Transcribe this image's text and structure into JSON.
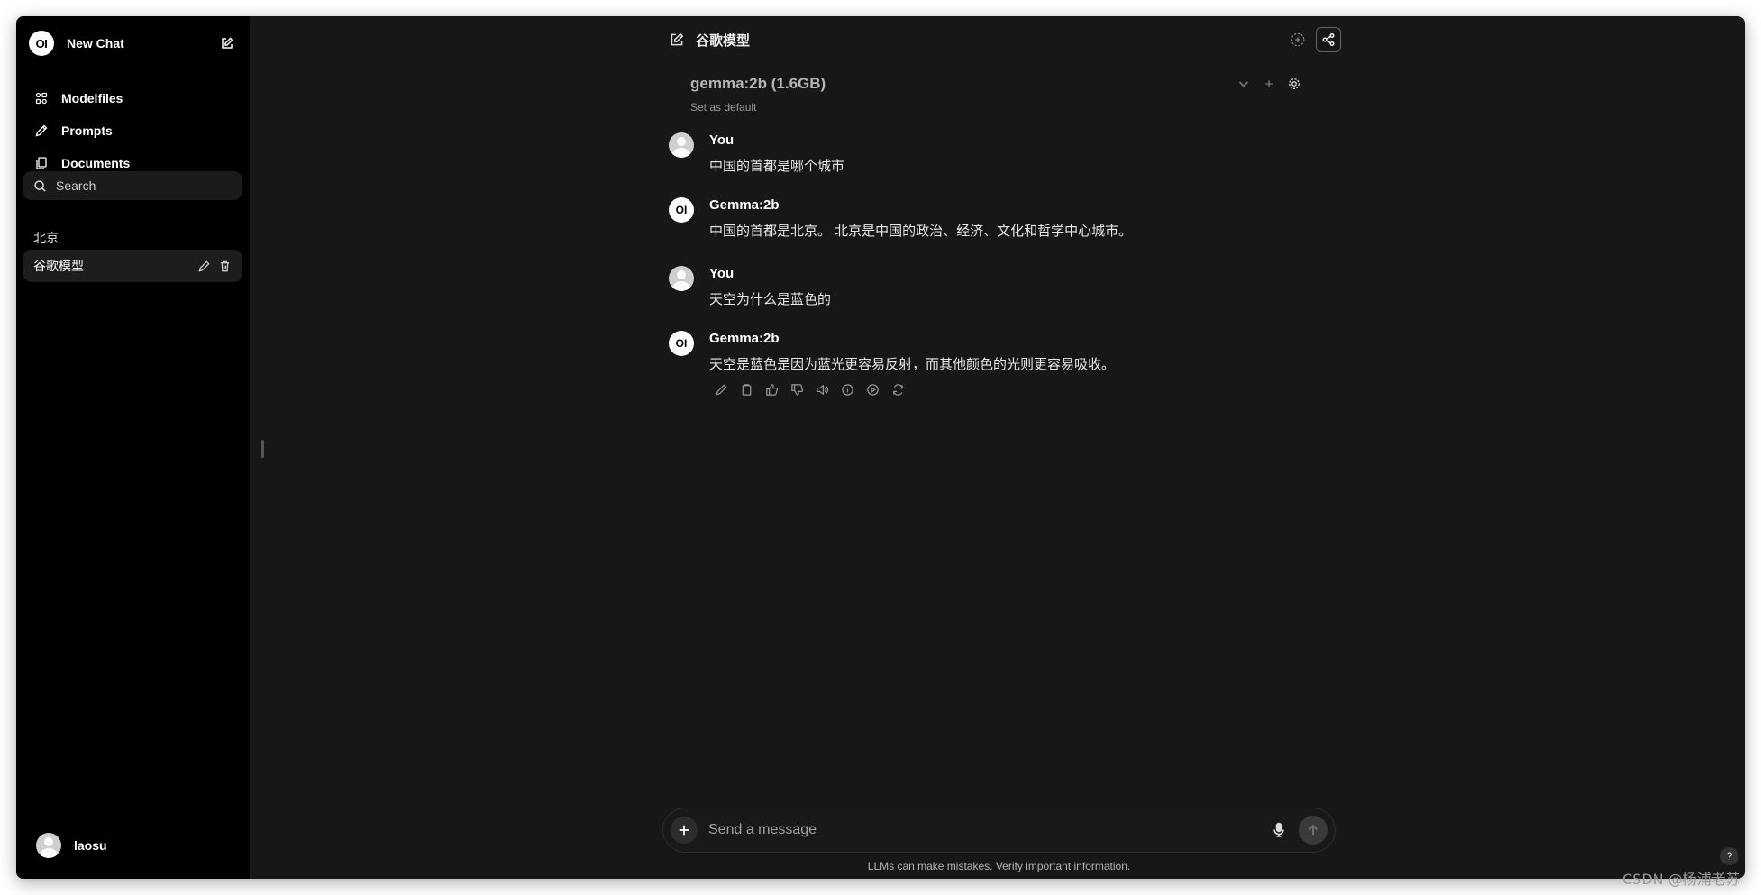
{
  "sidebar": {
    "logo_text": "OI",
    "new_chat_label": "New Chat",
    "nav": [
      {
        "label": "Modelfiles",
        "icon": "modelfiles-icon"
      },
      {
        "label": "Prompts",
        "icon": "pencil-icon"
      },
      {
        "label": "Documents",
        "icon": "documents-icon"
      }
    ],
    "search_placeholder": "Search",
    "group_label": "北京",
    "active_chat": "谷歌模型",
    "user_name": "laosu"
  },
  "header": {
    "title": "谷歌模型",
    "model_name": "gemma:2b (1.6GB)",
    "set_default": "Set as default"
  },
  "messages": [
    {
      "sender": "You",
      "text": "中国的首都是哪个城市",
      "role": "user"
    },
    {
      "sender": "Gemma:2b",
      "text": "中国的首都是北京。 北京是中国的政治、经济、文化和哲学中心城市。",
      "role": "assistant"
    },
    {
      "sender": "You",
      "text": "天空为什么是蓝色的",
      "role": "user"
    },
    {
      "sender": "Gemma:2b",
      "text": "天空是蓝色是因为蓝光更容易反射，而其他颜色的光则更容易吸收。",
      "role": "assistant"
    }
  ],
  "composer": {
    "placeholder": "Send a message"
  },
  "disclaimer": "LLMs can make mistakes. Verify important information.",
  "help_label": "?",
  "watermark": "CSDN @杨浦老苏",
  "colors": {
    "sidebar_bg": "#000000",
    "main_bg": "#171717",
    "active_item_bg": "#1d1d1d"
  }
}
